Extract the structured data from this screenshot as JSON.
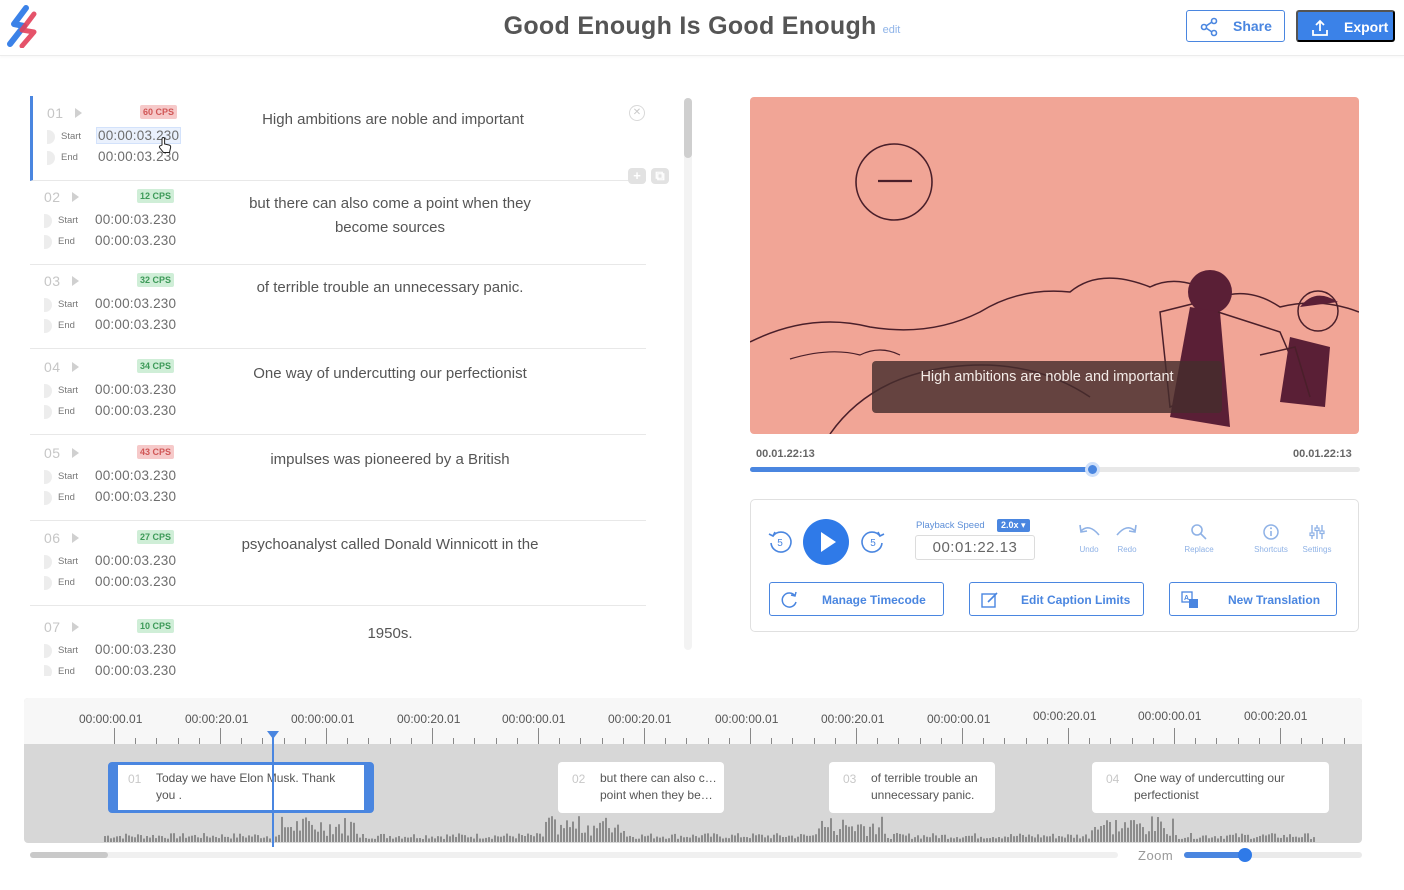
{
  "header": {
    "title": "Good Enough Is Good Enough",
    "edit_label": "edit",
    "share_label": "Share",
    "export_label": "Export"
  },
  "captions": [
    {
      "num": "01",
      "cps": "60 CPS",
      "cps_level": "high",
      "start_label": "Start",
      "end_label": "End",
      "start": "00:00:03.230",
      "end": "00:00:03.230",
      "text": "High ambitions are noble and important",
      "active": true
    },
    {
      "num": "02",
      "cps": "12 CPS",
      "cps_level": "ok",
      "start_label": "Start",
      "end_label": "End",
      "start": "00:00:03.230",
      "end": "00:00:03.230",
      "text": "but there can also come a point when they become sources"
    },
    {
      "num": "03",
      "cps": "32 CPS",
      "cps_level": "ok",
      "start_label": "Start",
      "end_label": "End",
      "start": "00:00:03.230",
      "end": "00:00:03.230",
      "text": "of terrible trouble an unnecessary panic."
    },
    {
      "num": "04",
      "cps": "34 CPS",
      "cps_level": "ok",
      "start_label": "Start",
      "end_label": "End",
      "start": "00:00:03.230",
      "end": "00:00:03.230",
      "text": "One way of undercutting our perfectionist"
    },
    {
      "num": "05",
      "cps": "43 CPS",
      "cps_level": "high",
      "start_label": "Start",
      "end_label": "End",
      "start": "00:00:03.230",
      "end": "00:00:03.230",
      "text": "impulses was pioneered by a British"
    },
    {
      "num": "06",
      "cps": "27 CPS",
      "cps_level": "ok",
      "start_label": "Start",
      "end_label": "End",
      "start": "00:00:03.230",
      "end": "00:00:03.230",
      "text": "psychoanalyst called Donald Winnicott in the"
    },
    {
      "num": "07",
      "cps": "10 CPS",
      "cps_level": "ok",
      "start_label": "Start",
      "end_label": "End",
      "start": "00:00:03.230",
      "end": "00:00:03.230",
      "text": "1950s."
    }
  ],
  "video": {
    "subtitle": "High ambitions are noble and important",
    "time_left": "00.01.22:13",
    "time_right": "00.01.22:13",
    "progress_fraction": 0.56
  },
  "controls": {
    "rewind_label": "5",
    "forward_label": "5",
    "playback_speed_label": "Playback Speed",
    "playback_speed_value": "2.0x",
    "current_time": "00:01:22.13",
    "tools": [
      {
        "label": "Undo",
        "icon": "undo-icon"
      },
      {
        "label": "Redo",
        "icon": "redo-icon"
      },
      {
        "label": "Replace",
        "icon": "search-icon"
      },
      {
        "label": "Shortcuts",
        "icon": "info-icon"
      },
      {
        "label": "Settings",
        "icon": "sliders-icon"
      }
    ],
    "manage_timecode_label": "Manage Timecode",
    "edit_caption_limits_label": "Edit Caption Limits",
    "new_translation_label": "New Translation"
  },
  "timeline": {
    "ticks": [
      "00:00:00.01",
      "00:00:20.01",
      "00:00:00.01",
      "00:00:20.01",
      "00:00:00.01",
      "00:00:20.01",
      "00:00:00.01",
      "00:00:20.01",
      "00:00:00.01",
      "00:00:20.01",
      "00:00:00.01",
      "00:00:20.01"
    ],
    "clips": [
      {
        "num": "01",
        "text": "Today we have Elon Musk. Thank you .",
        "selected": true
      },
      {
        "num": "02",
        "text": "but there can also c… point when they be…"
      },
      {
        "num": "03",
        "text": "of terrible trouble an unnecessary panic."
      },
      {
        "num": "04",
        "text": "One way of undercutting our perfectionist"
      }
    ],
    "zoom_label": "Zoom",
    "zoom_fraction": 0.34
  },
  "colors": {
    "accent": "#3b82e8",
    "video_bg": "#f1a596",
    "cps_high": "#d05656",
    "cps_ok": "#3d9a58"
  }
}
